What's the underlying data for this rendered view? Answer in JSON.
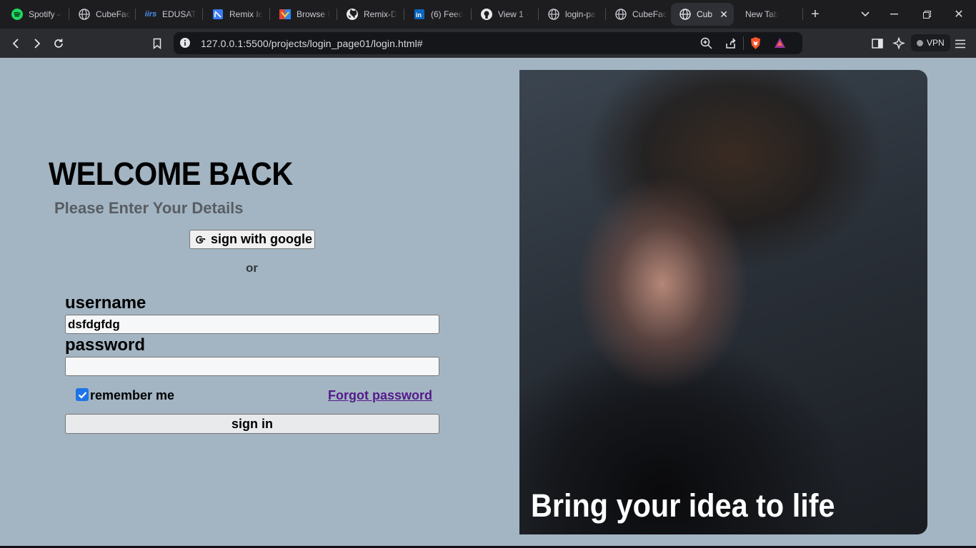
{
  "browser": {
    "tabs": [
      {
        "title": "Spotify –",
        "icon": "spotify-icon"
      },
      {
        "title": "CubeFac",
        "icon": "globe-icon"
      },
      {
        "title": "EDUSAT",
        "icon": "iirs-icon"
      },
      {
        "title": "Remix Ic",
        "icon": "remix-icon"
      },
      {
        "title": "Browse I",
        "icon": "browse-icon"
      },
      {
        "title": "Remix-D",
        "icon": "github-icon"
      },
      {
        "title": "(6) Feed",
        "icon": "linkedin-icon"
      },
      {
        "title": "View 1 ·",
        "icon": "github-icon"
      },
      {
        "title": "login-pa",
        "icon": "globe-icon"
      },
      {
        "title": "CubeFac",
        "icon": "globe-icon"
      },
      {
        "title": "Cub",
        "icon": "globe-icon",
        "active": true
      },
      {
        "title": "New Tab",
        "icon": ""
      }
    ],
    "url": "127.0.0.1:5500/projects/login_page01/login.html#",
    "vpn_label": "VPN",
    "accent_color": "#1e73e8"
  },
  "login": {
    "heading": "WELCOME BACK",
    "subtitle": "Please Enter Your Details",
    "google_button": "sign with google",
    "or_text": "or",
    "username_label": "username",
    "username_value": "dsfdgfdg",
    "password_label": "password",
    "password_value": "",
    "remember_label": "remember me",
    "remember_checked": true,
    "forgot_link": "Forgot password",
    "signin_button": "sign in"
  },
  "hero": {
    "caption": "Bring your idea to life"
  }
}
